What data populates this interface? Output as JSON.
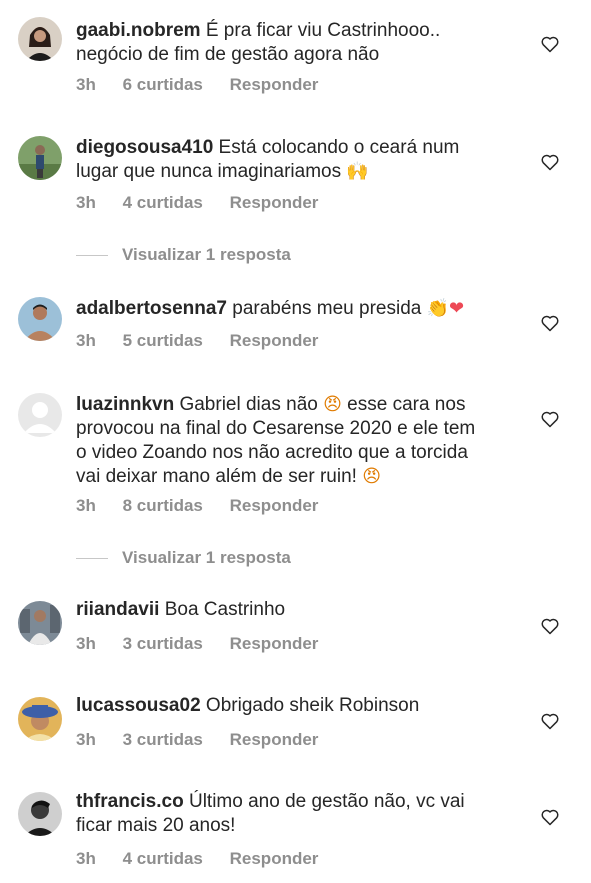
{
  "comments": [
    {
      "user": "gaabi.nobrem",
      "text_line1": " É pra ficar viu Castrinhooo..",
      "text_line2": "negócio de fim de gestão agora não",
      "time": "3h",
      "likes": "6 curtidas",
      "reply": "Responder",
      "avatar_icon": "avatar-woman-icon"
    },
    {
      "user": "diegosousa410",
      "text_line1": " Está colocando o ceará num",
      "text_line2": "lugar que nunca imaginariamos",
      "emoji": "🙌",
      "time": "3h",
      "likes": "4 curtidas",
      "reply": "Responder",
      "avatar_icon": "avatar-man-outdoor-icon"
    },
    {
      "user": "adalbertosenna7",
      "text_line1": " parabéns meu presida",
      "emoji": "👏❤",
      "time": "3h",
      "likes": "5 curtidas",
      "reply": "Responder",
      "avatar_icon": "avatar-man-shirtless-icon"
    },
    {
      "user": "luazinnkvn",
      "text_line1": " Gabriel dias não ",
      "emoji_inline": "😠",
      "text_line1b": " esse cara nos",
      "text_line2": "provocou na final do Cesarense 2020 e ele tem",
      "text_line3": "o video Zoando nos não acredito que a torcida",
      "text_line4": "vai deixar mano além de ser ruin! ",
      "emoji_end": "😠",
      "time": "3h",
      "likes": "8 curtidas",
      "reply": "Responder",
      "avatar_icon": "avatar-placeholder-icon"
    },
    {
      "user": "riiandavii",
      "text_line1": " Boa Castrinho",
      "time": "3h",
      "likes": "3 curtidas",
      "reply": "Responder",
      "avatar_icon": "avatar-man-city-icon"
    },
    {
      "user": "lucassousa02",
      "text_line1": " Obrigado sheik Robinson",
      "time": "3h",
      "likes": "3 curtidas",
      "reply": "Responder",
      "avatar_icon": "avatar-man-hat-icon"
    },
    {
      "user": "thfrancis.co",
      "text_line1": " Último ano de gestão não, vc vai",
      "text_line2": "ficar mais 20 anos!",
      "time": "3h",
      "likes": "4 curtidas",
      "reply": "Responder",
      "avatar_icon": "avatar-man-dark-icon"
    }
  ],
  "view_replies": [
    "Visualizar 1 resposta",
    "Visualizar 1 resposta"
  ],
  "colors": {
    "meta": "#8e8e8e",
    "text": "#262626",
    "heart_red": "#ed4956"
  }
}
